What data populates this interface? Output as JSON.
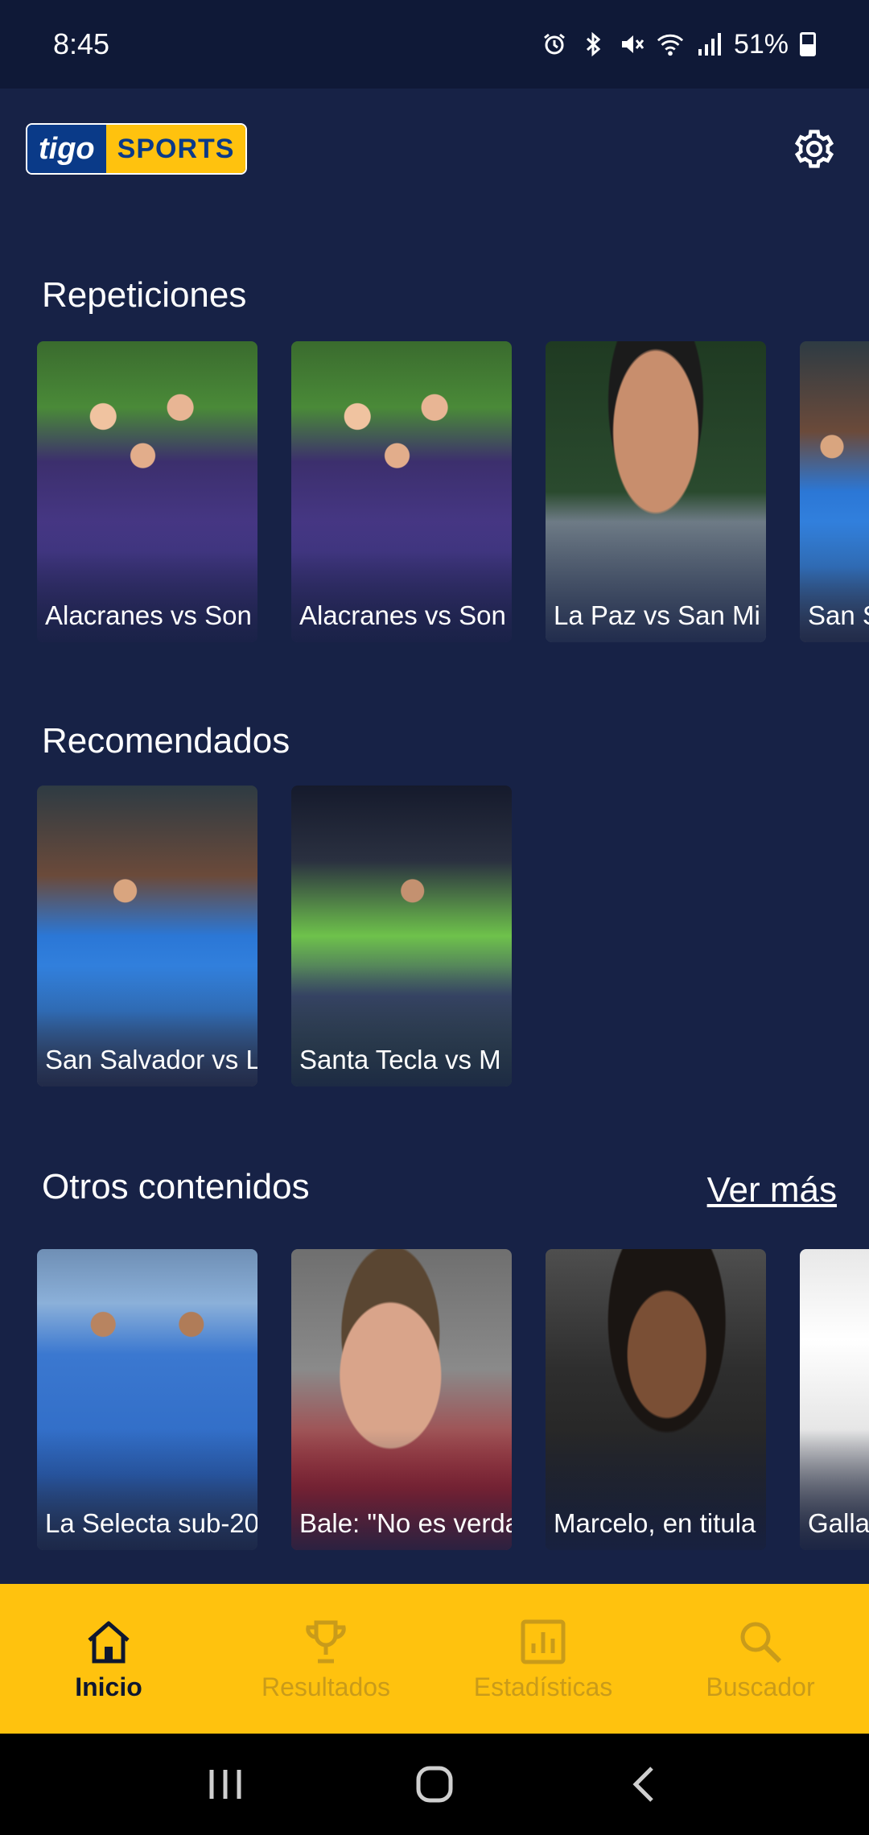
{
  "status_bar": {
    "time": "8:45",
    "battery": "51%",
    "icons": [
      "alarm-icon",
      "bluetooth-icon",
      "mute-icon",
      "wifi-icon",
      "signal-icon",
      "battery-icon"
    ]
  },
  "header": {
    "logo_left": "tigo",
    "logo_right": "SPORTS",
    "settings_icon": "gear-icon"
  },
  "sections": {
    "repeticiones": {
      "title": "Repeticiones",
      "items": [
        {
          "title": "Alacranes vs Son"
        },
        {
          "title": "Alacranes vs Son"
        },
        {
          "title": "La Paz vs San Mi"
        },
        {
          "title": "San S"
        }
      ]
    },
    "recomendados": {
      "title": "Recomendados",
      "items": [
        {
          "title": "San Salvador vs L"
        },
        {
          "title": "Santa Tecla vs M"
        }
      ]
    },
    "otros": {
      "title": "Otros contenidos",
      "see_more": "Ver más",
      "items": [
        {
          "title": "La Selecta sub-20"
        },
        {
          "title": "Bale: \"No es verda"
        },
        {
          "title": "Marcelo, en titula"
        },
        {
          "title": "Galla"
        }
      ]
    }
  },
  "bottom_nav": {
    "items": [
      {
        "label": "Inicio",
        "icon": "home-icon",
        "active": true
      },
      {
        "label": "Resultados",
        "icon": "trophy-icon",
        "active": false
      },
      {
        "label": "Estadísticas",
        "icon": "stats-icon",
        "active": false
      },
      {
        "label": "Buscador",
        "icon": "search-icon",
        "active": false
      }
    ]
  },
  "colors": {
    "background": "#172246",
    "status_bar": "#0f1937",
    "accent_yellow": "#ffc20e",
    "nav_active": "#0e1730",
    "nav_inactive": "#c99b1a"
  }
}
